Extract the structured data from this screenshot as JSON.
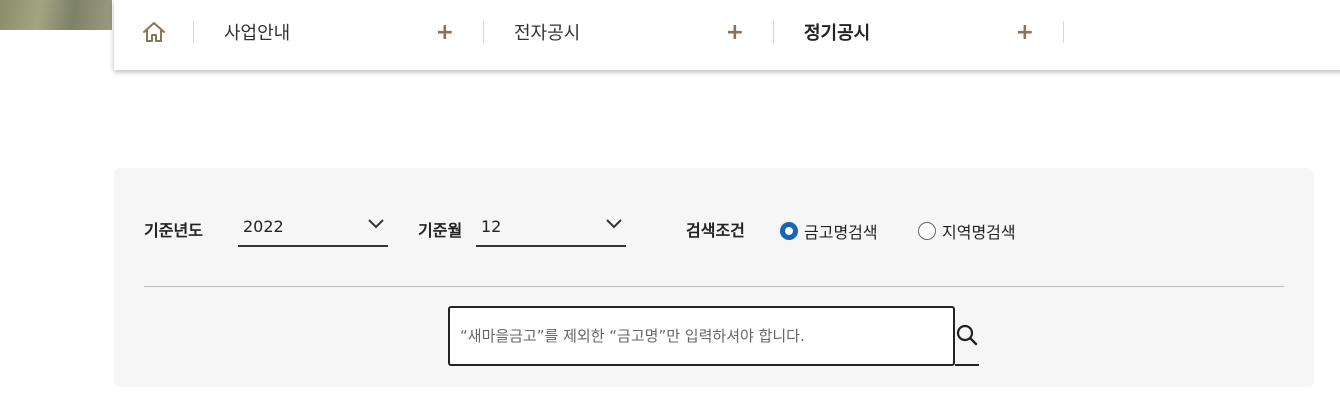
{
  "nav": {
    "home_icon": "home-icon",
    "menus": [
      {
        "label": "사업안내",
        "icon": "plus-icon"
      },
      {
        "label": "전자공시",
        "icon": "plus-icon"
      },
      {
        "label": "정기공시",
        "icon": "plus-icon",
        "active": true
      }
    ]
  },
  "filters": {
    "year_label": "기준년도",
    "year_value": "2022",
    "month_label": "기준월",
    "month_value": "12",
    "condition_label": "검색조건",
    "radio_options": [
      {
        "label": "금고명검색",
        "checked": true
      },
      {
        "label": "지역명검색",
        "checked": false
      }
    ]
  },
  "search": {
    "placeholder": "“새마을금고”를 제외한 “금고명”만 입력하셔야 합니다.",
    "value": "",
    "icon": "search-icon"
  },
  "colors": {
    "accent": "#8b7355",
    "radio_checked": "#1665b8",
    "panel_bg": "#f6f6f6"
  }
}
